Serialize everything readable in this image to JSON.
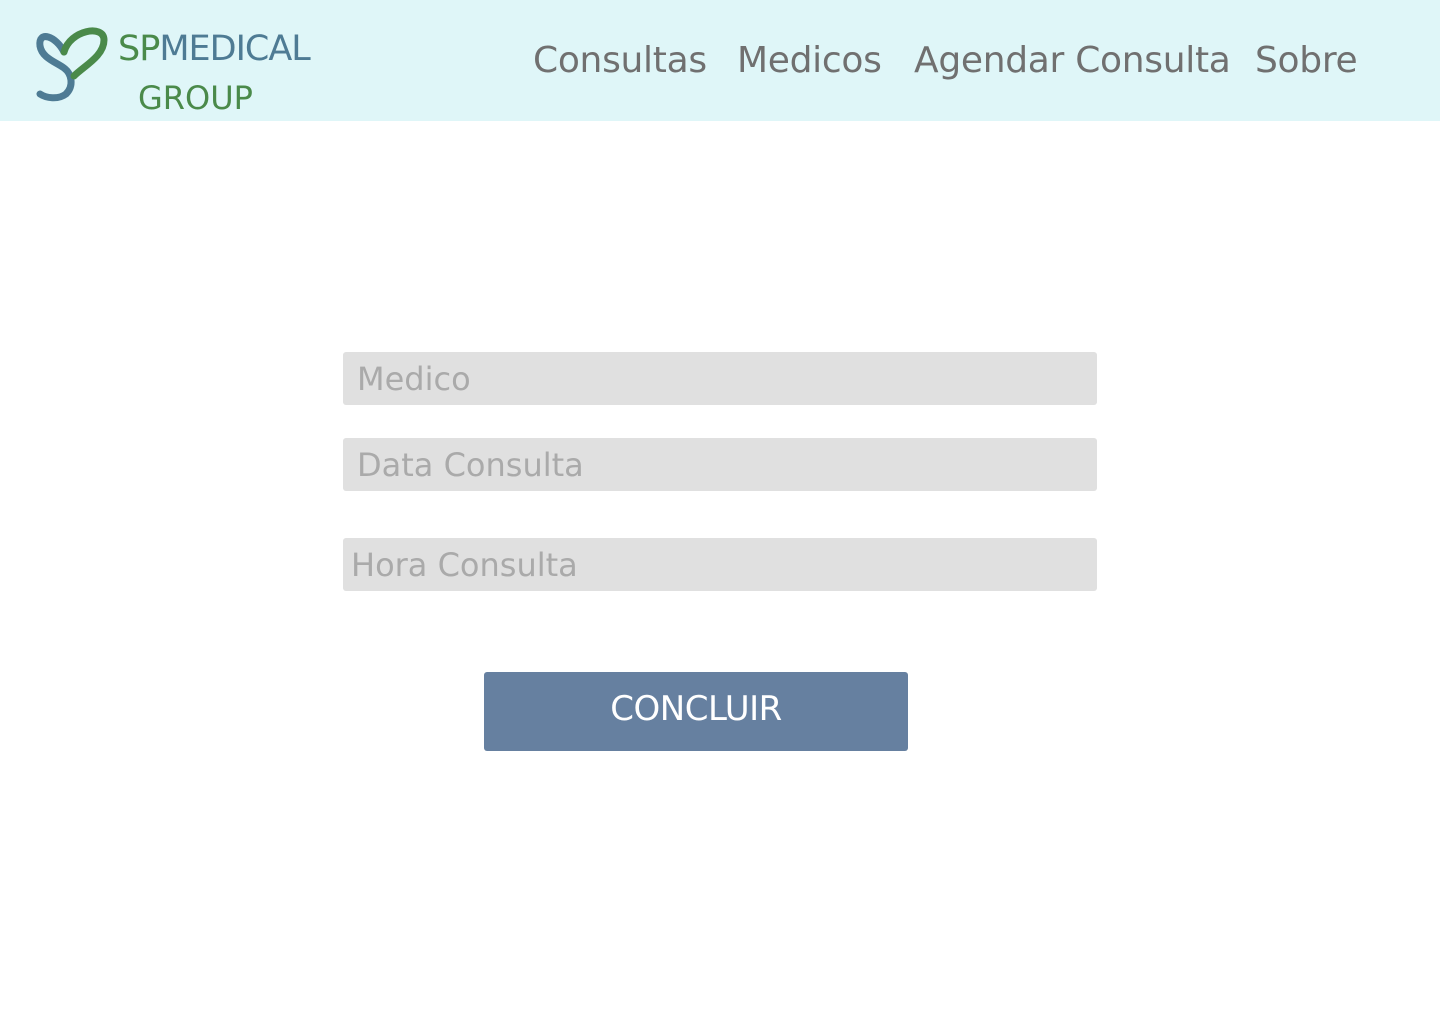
{
  "brand": {
    "name_part1": "SP",
    "name_part2": "MEDICAL",
    "name_line2": "GROUP",
    "icon": "heart-s-logo-icon",
    "colors": {
      "green": "#4a8a4a",
      "blue": "#4e7b94"
    }
  },
  "nav": {
    "items": [
      {
        "label": "Consultas"
      },
      {
        "label": "Medicos"
      },
      {
        "label": "Agendar Consulta"
      },
      {
        "label": "Sobre"
      }
    ]
  },
  "form": {
    "medico": {
      "placeholder": "Medico",
      "value": ""
    },
    "data_consulta": {
      "placeholder": "Data Consulta",
      "value": ""
    },
    "hora_consulta": {
      "placeholder": "Hora Consulta",
      "value": ""
    },
    "submit_label": "CONCLUIR"
  },
  "colors": {
    "header_bg": "#dff6f8",
    "field_bg": "#e0e0e0",
    "button_bg": "#6680a0",
    "nav_text": "#707070"
  }
}
